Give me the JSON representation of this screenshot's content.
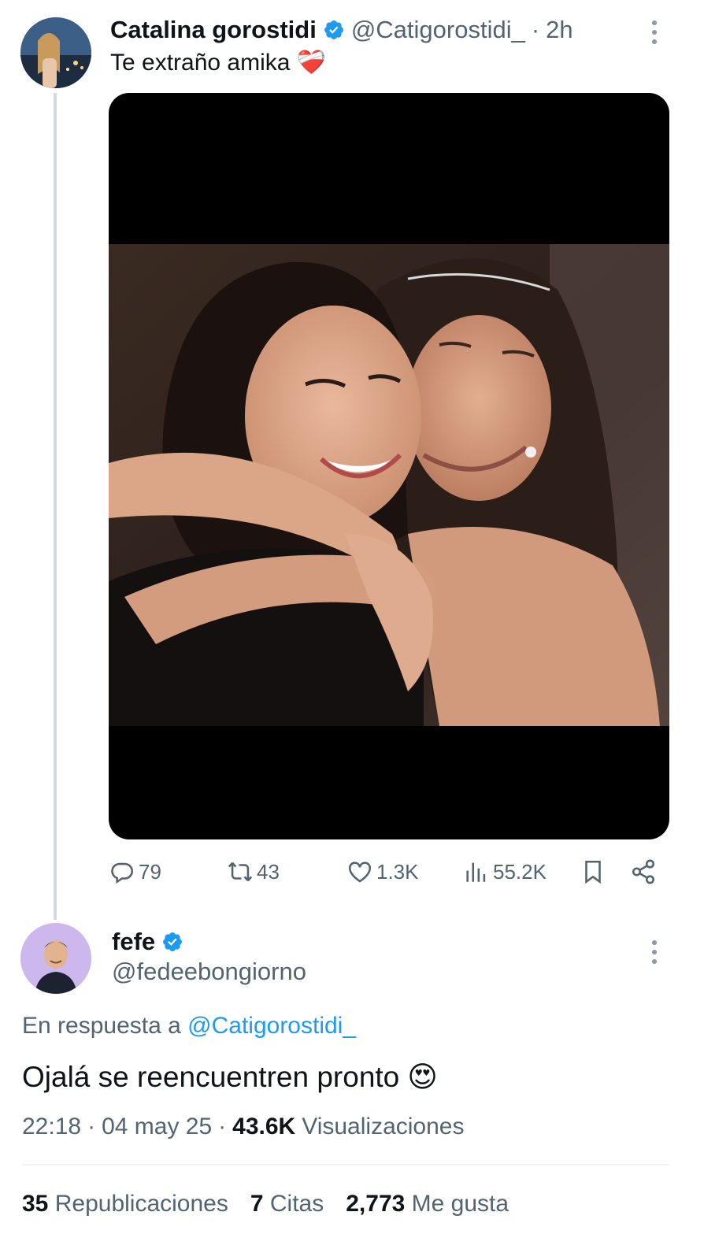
{
  "tweet1": {
    "display_name": "Catalina gorostidi",
    "handle": "@Catigorostidi_",
    "separator": "·",
    "time": "2h",
    "text": "Te extraño amika",
    "text_emoji": "❤️‍🩹",
    "stats": {
      "replies": "79",
      "retweets": "43",
      "likes": "1.3K",
      "views": "55.2K"
    },
    "icons": [
      "reply-icon",
      "retweet-icon",
      "like-icon",
      "views-icon",
      "bookmark-icon",
      "share-icon"
    ]
  },
  "tweet2": {
    "display_name": "fefe",
    "handle": "@fedeebongiorno",
    "reply_prefix": "En respuesta a",
    "reply_to": "@Catigorostidi_",
    "text": "Ojalá se reencuentren pronto",
    "text_emoji": "😍",
    "time": "22:18",
    "date": "04 may 25",
    "views_count": "43.6K",
    "views_label": "Visualizaciones",
    "dot": "·",
    "reposts_count": "35",
    "reposts_label": "Republicaciones",
    "quotes_count": "7",
    "quotes_label": "Citas",
    "likes_count": "2,773",
    "likes_label": "Me gusta"
  },
  "colors": {
    "accent": "#1d9bf0",
    "text": "#0f1419",
    "muted": "#536471",
    "thread_line": "#cfd9de"
  }
}
